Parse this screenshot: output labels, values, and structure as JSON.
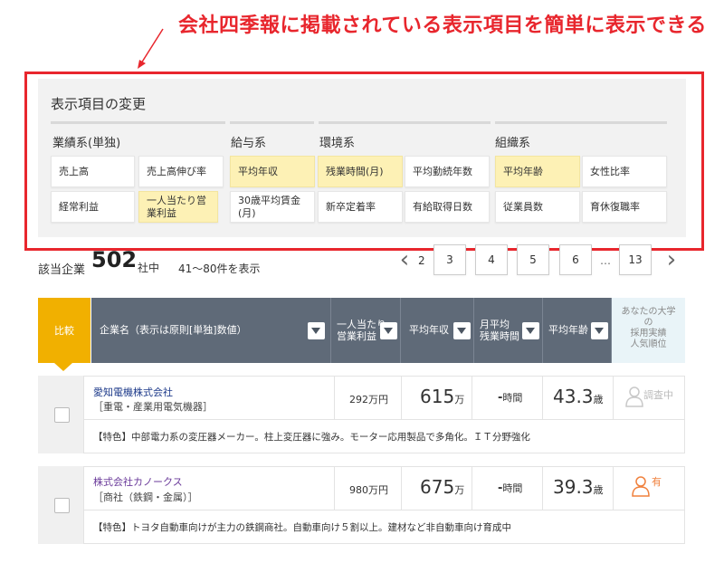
{
  "annotation": {
    "title": "会社四季報に掲載されている表示項目を簡単に表示できる",
    "color": "#e8262d"
  },
  "panel": {
    "title": "表示項目の変更",
    "groups": [
      {
        "title": "業績系(単独)",
        "items": [
          {
            "label": "売上高",
            "selected": false
          },
          {
            "label": "売上高伸び率",
            "selected": false
          },
          {
            "label": "経常利益",
            "selected": false
          },
          {
            "label": "一人当たり営業利益",
            "selected": true
          }
        ]
      },
      {
        "title": "給与系",
        "items": [
          {
            "label": "平均年収",
            "selected": true
          },
          {
            "label": "30歳平均賃金(月)",
            "selected": false
          }
        ]
      },
      {
        "title": "環境系",
        "items": [
          {
            "label": "残業時間(月)",
            "selected": true
          },
          {
            "label": "平均勤続年数",
            "selected": false
          },
          {
            "label": "新卒定着率",
            "selected": false
          },
          {
            "label": "有給取得日数",
            "selected": false
          }
        ]
      },
      {
        "title": "組織系",
        "items": [
          {
            "label": "平均年齢",
            "selected": true
          },
          {
            "label": "女性比率",
            "selected": false
          },
          {
            "label": "従業員数",
            "selected": false
          },
          {
            "label": "育休復職率",
            "selected": false
          }
        ]
      }
    ],
    "selected_color": "#fdf1b5"
  },
  "results": {
    "label": "該当企業",
    "count": "502",
    "unit": "社中",
    "range": "41〜80件を表示"
  },
  "pagination": {
    "prev": "‹",
    "current": "2",
    "pages": [
      "3",
      "4",
      "5",
      "6"
    ],
    "ellipsis": "…",
    "last": "13",
    "next": "›"
  },
  "table": {
    "compare_header": "比較",
    "headers": {
      "name": "企業名（表示は原則[単独]数値）",
      "profit_line1": "一人当たり",
      "profit_line2": "営業利益",
      "salary": "平均年収",
      "overtime_line1": "月平均",
      "overtime_line2": "残業時間",
      "age": "平均年齢",
      "uni_line1": "あなたの大学",
      "uni_line2": "の",
      "uni_line3": "採用実績",
      "uni_line4": "人気順位"
    },
    "header_color": "#5f6a78",
    "accent_color": "#f1b000",
    "rows": [
      {
        "name": "愛知電機株式会社",
        "industry": "［重電・産業用電気機器］",
        "profit": "292万円",
        "salary": "615",
        "salary_unit": "万",
        "overtime": "-",
        "overtime_unit": "時間",
        "age": "43.3",
        "age_unit": "歳",
        "uni_status": "調査中",
        "feature": "【特色】中部電力系の変圧器メーカー。柱上変圧器に強み。モーター応用製品で多角化。ＩＴ分野強化"
      },
      {
        "name": "株式会社カノークス",
        "industry": "［商社（鉄鋼・金属）］",
        "profit": "980万円",
        "salary": "675",
        "salary_unit": "万",
        "overtime": "-",
        "overtime_unit": "時間",
        "age": "39.3",
        "age_unit": "歳",
        "uni_status": "有",
        "feature": "【特色】トヨタ自動車向けが主力の鉄鋼商社。自動車向け５割以上。建材など非自動車向け育成中"
      }
    ]
  }
}
